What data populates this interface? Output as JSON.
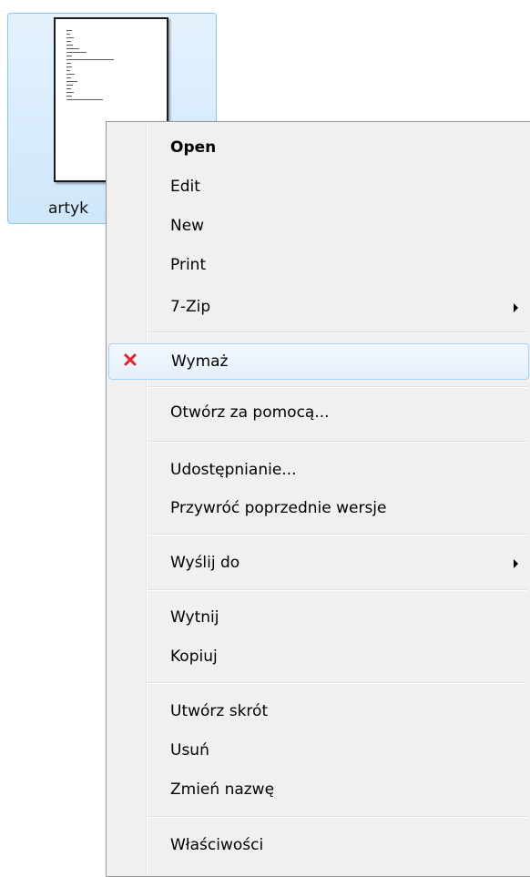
{
  "desktop": {
    "file_label": "artyk"
  },
  "context_menu": {
    "items": [
      {
        "label": "Open"
      },
      {
        "label": "Edit"
      },
      {
        "label": "New"
      },
      {
        "label": "Print"
      },
      {
        "label": "7-Zip"
      },
      {
        "label": "Wymaż",
        "icon": "red-x-icon"
      },
      {
        "label": "Otwórz za pomocą..."
      },
      {
        "label": "Udostępnianie..."
      },
      {
        "label": "Przywróć poprzednie wersje"
      },
      {
        "label": "Wyślij do"
      },
      {
        "label": "Wytnij"
      },
      {
        "label": "Kopiuj"
      },
      {
        "label": "Utwórz skrót"
      },
      {
        "label": "Usuń"
      },
      {
        "label": "Zmień nazwę"
      },
      {
        "label": "Właściwości"
      }
    ]
  },
  "colors": {
    "selection_bg": "#cfe7fb",
    "selection_border": "#8dc4ed",
    "menu_bg": "#f0f0f0",
    "hover_border": "#a8d0f0",
    "erase_icon": "#e8202a"
  }
}
